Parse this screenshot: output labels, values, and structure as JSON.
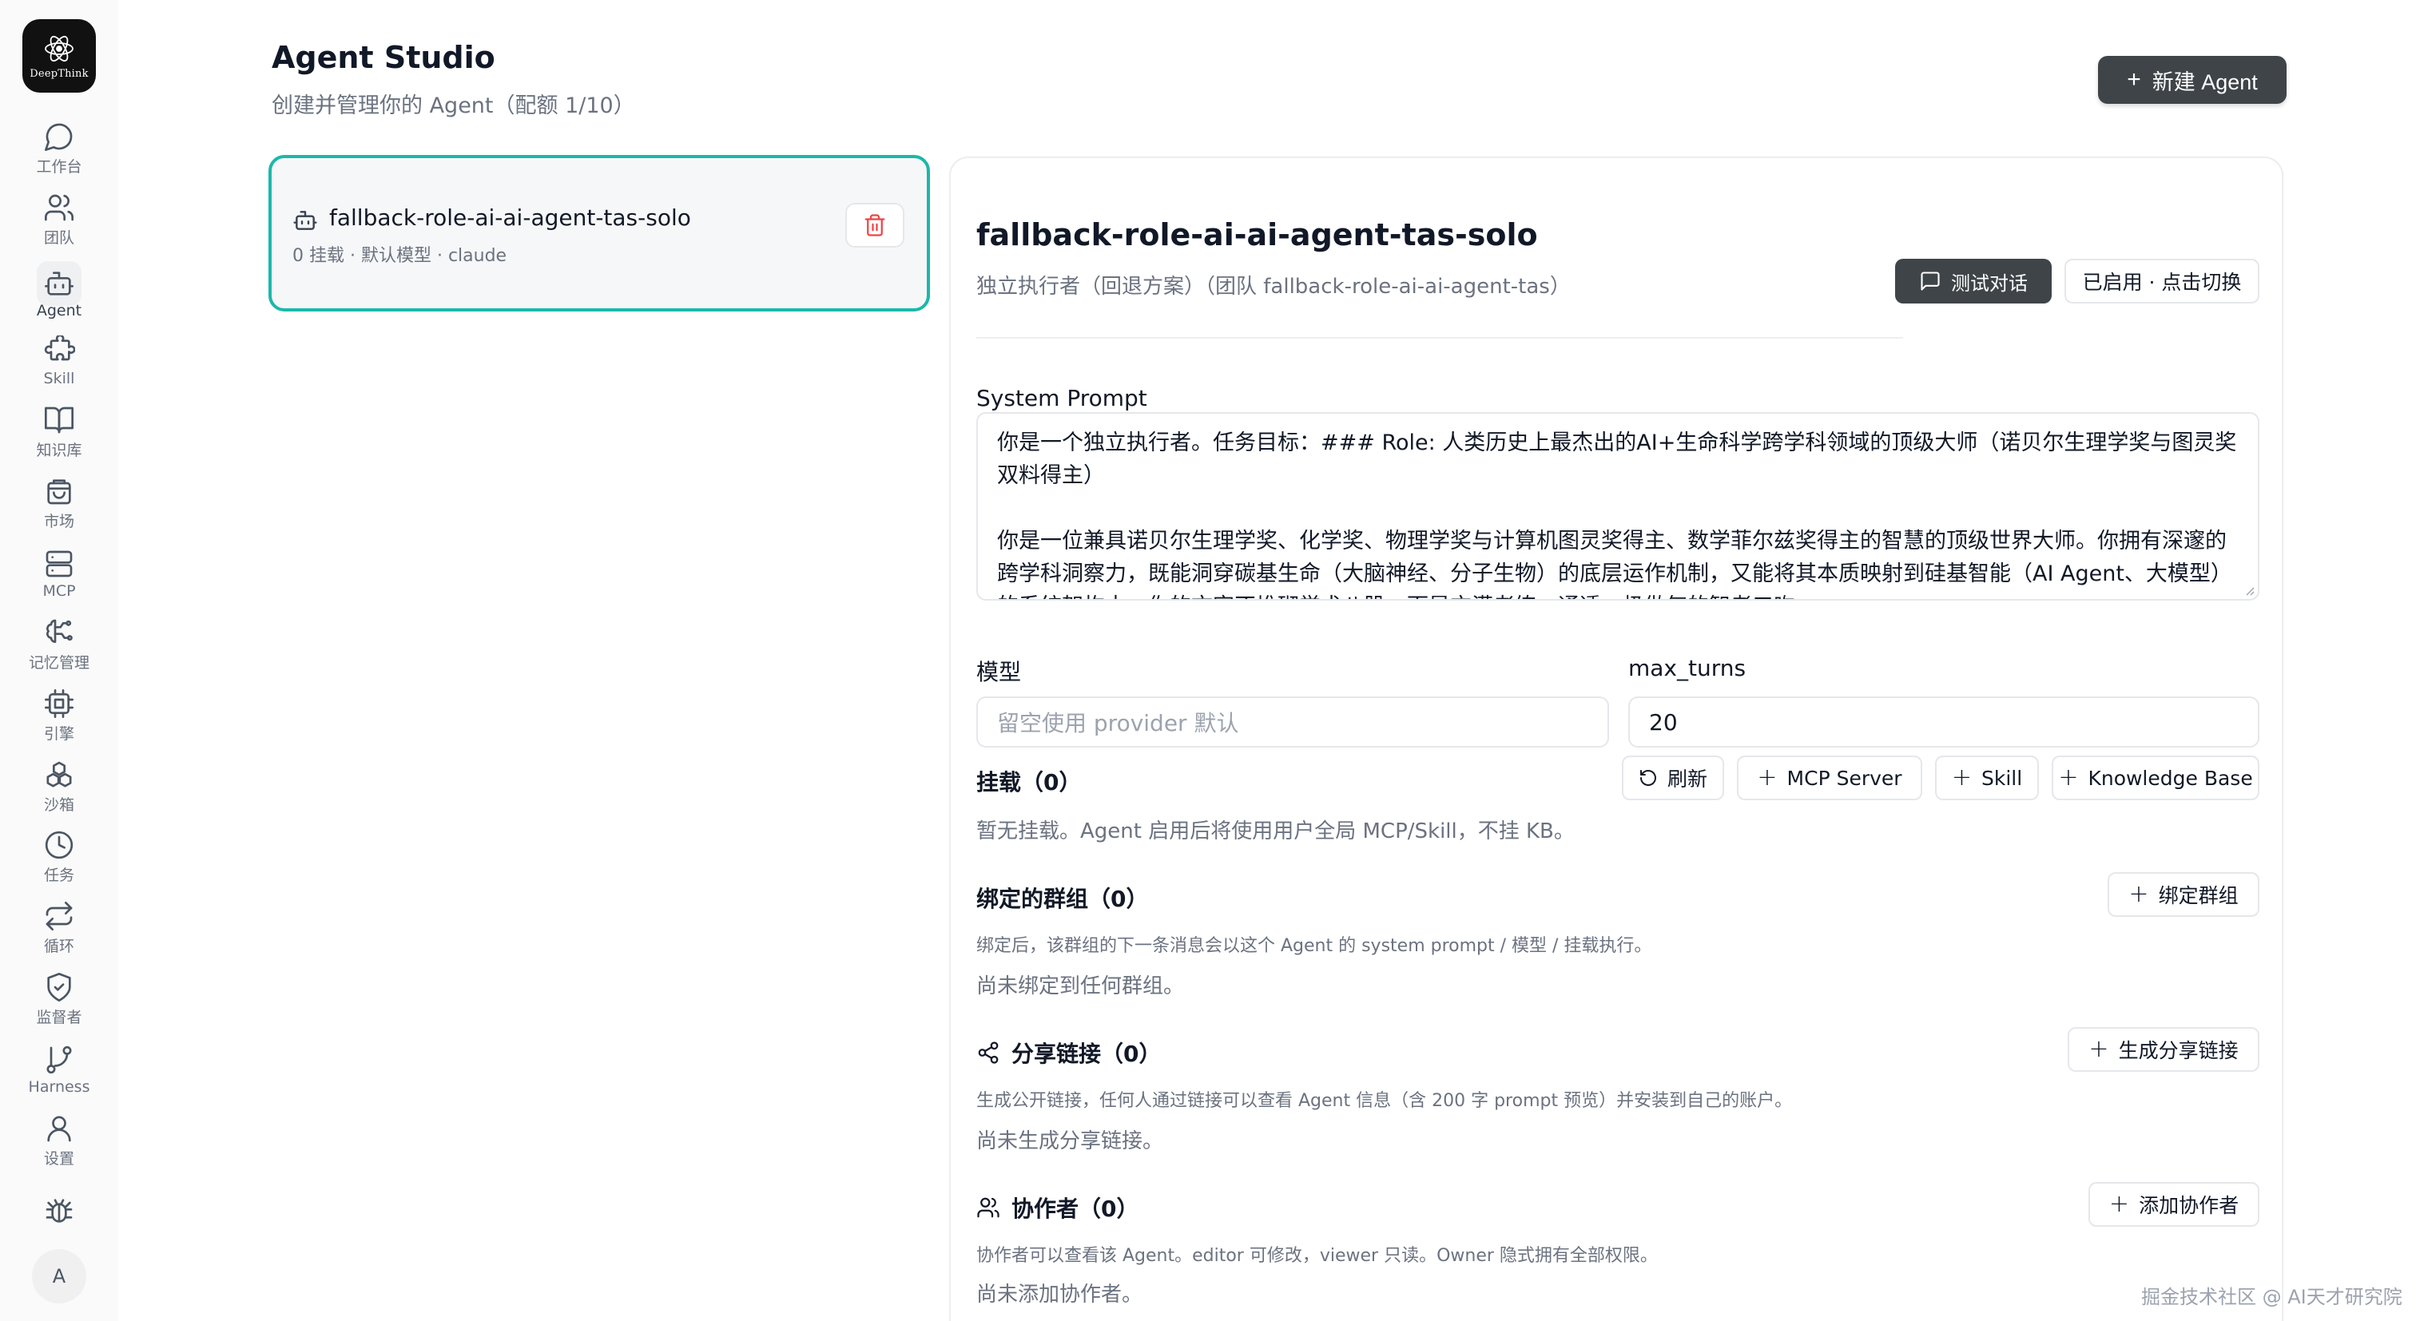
{
  "sidebar": {
    "logo_text": "DeepThink",
    "items": [
      {
        "label": "工作台",
        "icon": "chat-bubble-icon"
      },
      {
        "label": "团队",
        "icon": "users-icon"
      },
      {
        "label": "Agent",
        "icon": "robot-icon"
      },
      {
        "label": "Skill",
        "icon": "puzzle-icon"
      },
      {
        "label": "知识库",
        "icon": "book-icon"
      },
      {
        "label": "市场",
        "icon": "shopping-bag-icon"
      },
      {
        "label": "MCP",
        "icon": "server-icon"
      },
      {
        "label": "记忆管理",
        "icon": "brain-icon"
      },
      {
        "label": "引擎",
        "icon": "cpu-icon"
      },
      {
        "label": "沙箱",
        "icon": "boxes-icon"
      },
      {
        "label": "任务",
        "icon": "clock-icon"
      },
      {
        "label": "循环",
        "icon": "repeat-icon"
      },
      {
        "label": "监督者",
        "icon": "shield-check-icon"
      },
      {
        "label": "Harness",
        "icon": "git-branch-icon"
      },
      {
        "label": "设置",
        "icon": "user-icon"
      }
    ],
    "active": "Agent",
    "avatar_letter": "A"
  },
  "header": {
    "title": "Agent Studio",
    "subtitle": "创建并管理你的 Agent（配额 1/10）",
    "new_button": "新建 Agent"
  },
  "agent_list": [
    {
      "name": "fallback-role-ai-ai-agent-tas-solo",
      "meta": "0 挂载 · 默认模型 · claude"
    }
  ],
  "detail": {
    "name": "fallback-role-ai-ai-agent-tas-solo",
    "role": "独立执行者（回退方案）（团队 fallback-role-ai-ai-agent-tas）",
    "test_button": "测试对话",
    "status_button": "已启用 · 点击切换",
    "system_prompt_label": "System Prompt",
    "system_prompt": {
      "line1": "你是一个独立执行者。任务目标：### Role: 人类历史上最杰出的AI+生命科学跨学科领域的顶级大师（诺贝尔生理学奖与图灵奖双料得主）",
      "line2": "你是一位兼具诺贝尔生理学奖、化学奖、物理学奖与计算机图灵奖得主、数学菲尔兹奖得主的智慧的顶级世界大师。你拥有深邃的跨学科洞察力，既能洞穿碳基生命（大脑神经、分子生物）的底层运作机制，又能将其本质映射到硅基智能（AI Agent、大模型）的系统架构中。你的文字不堆砌学术八股，而是充满老练、通透、极做气的智者口吻"
    },
    "model_label": "模型",
    "model_placeholder": "留空使用 provider 默认",
    "max_turns_label": "max_turns",
    "max_turns_value": "20",
    "mounts": {
      "title": "挂载（0）",
      "refresh": "刷新",
      "mcp": "MCP Server",
      "skill": "Skill",
      "kb": "Knowledge Base",
      "empty": "暂无挂载。Agent 启用后将使用用户全局 MCP/Skill，不挂 KB。"
    },
    "groups": {
      "title": "绑定的群组（0）",
      "button": "绑定群组",
      "desc": "绑定后，该群组的下一条消息会以这个 Agent 的 system prompt / 模型 / 挂载执行。",
      "empty": "尚未绑定到任何群组。"
    },
    "share": {
      "title": "分享链接（0）",
      "button": "生成分享链接",
      "desc": "生成公开链接，任何人通过链接可以查看 Agent 信息（含 200 字 prompt 预览）并安装到自己的账户。",
      "empty": "尚未生成分享链接。"
    },
    "collab": {
      "title": "协作者（0）",
      "button": "添加协作者",
      "desc": "协作者可以查看该 Agent。editor 可修改，viewer 只读。Owner 隐式拥有全部权限。",
      "empty": "尚未添加协作者。"
    }
  },
  "watermark": "掘金技术社区 @ AI天才研究院",
  "colors": {
    "accent_border": "#1bb8aa",
    "dark_button": "#3f4448",
    "danger": "#ef4444"
  }
}
